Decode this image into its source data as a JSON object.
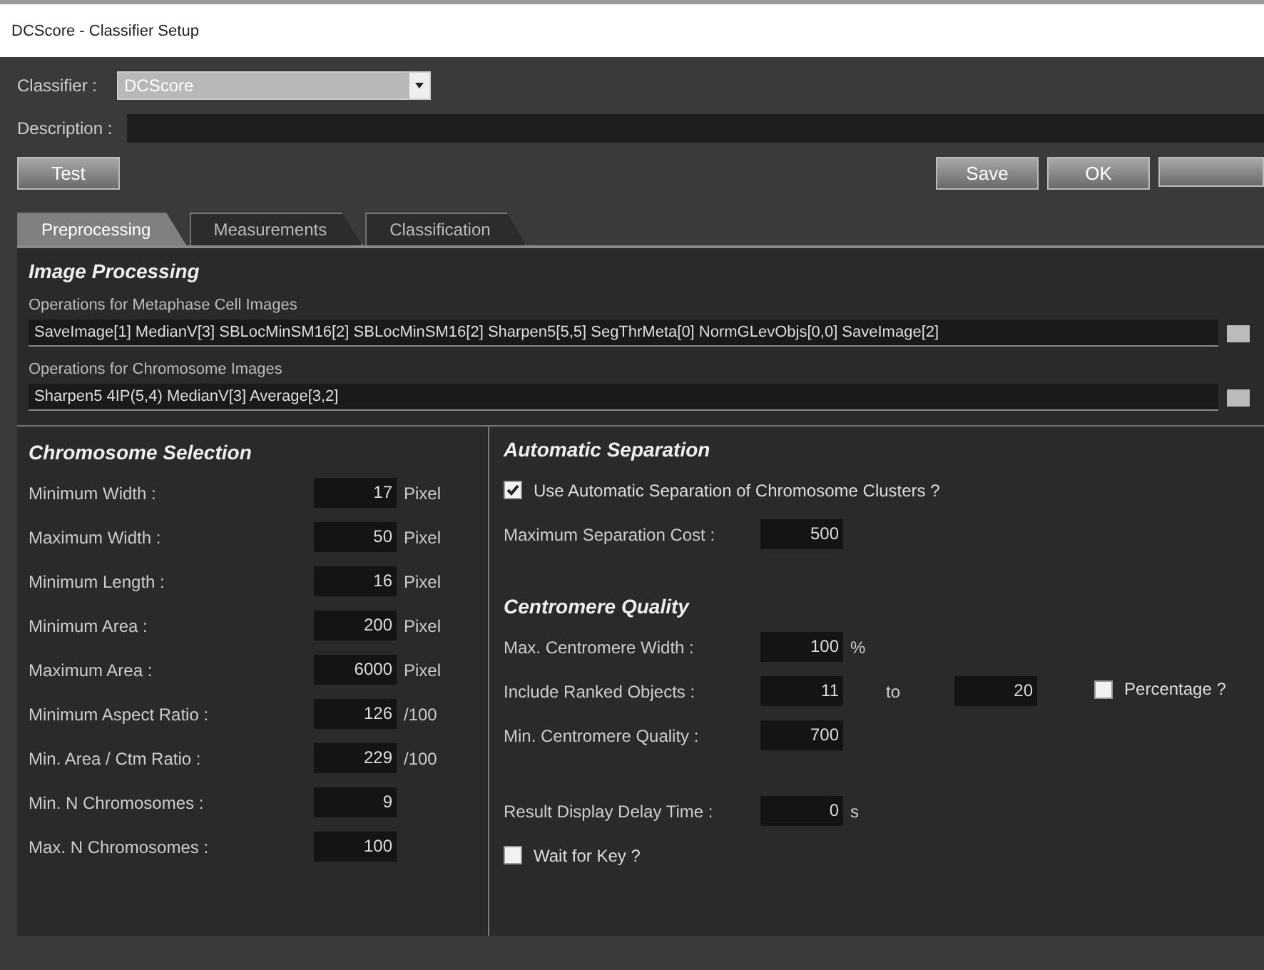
{
  "window": {
    "title": "DCScore - Classifier Setup"
  },
  "classifier": {
    "label": "Classifier :",
    "value": "DCScore"
  },
  "description": {
    "label": "Description :"
  },
  "test_button": "Test",
  "actions": [
    "Save",
    "OK"
  ],
  "tabs": [
    {
      "label": "Preprocessing",
      "selected": true
    },
    {
      "label": "Measurements",
      "selected": false
    },
    {
      "label": "Classification",
      "selected": false
    }
  ],
  "image_processing": {
    "title": "Image Processing",
    "operations": [
      {
        "label": "Operations for Metaphase Cell Images",
        "value": "SaveImage[1] MedianV[3] SBLocMinSM16[2] SBLocMinSM16[2] Sharpen5[5,5] SegThrMeta[0] NormGLevObjs[0,0] SaveImage[2]"
      },
      {
        "label": "Operations for Chromosome Images",
        "value": "Sharpen5 4IP(5,4) MedianV[3] Average[3,2]"
      }
    ]
  },
  "chromosome_selection": {
    "title": "Chromosome Selection",
    "fields": [
      {
        "label": "Minimum Width :",
        "value": "17",
        "unit": "Pixel"
      },
      {
        "label": "Maximum Width :",
        "value": "50",
        "unit": "Pixel"
      },
      {
        "label": "Minimum Length :",
        "value": "16",
        "unit": "Pixel"
      },
      {
        "label": "Minimum Area :",
        "value": "200",
        "unit": "Pixel"
      },
      {
        "label": "Maximum Area :",
        "value": "6000",
        "unit": "Pixel"
      },
      {
        "label": "Minimum Aspect Ratio :",
        "value": "126",
        "unit": "/100"
      },
      {
        "label": "Min. Area / Ctm Ratio :",
        "value": "229",
        "unit": "/100"
      },
      {
        "label": "Min. N Chromosomes :",
        "value": "9"
      },
      {
        "label": "Max. N Chromosomes :",
        "value": "100"
      }
    ]
  },
  "automatic_separation": {
    "title": "Automatic Separation",
    "use": {
      "label": "Use Automatic Separation of Chromosome Clusters ?",
      "checked": true
    },
    "cost": {
      "label": "Maximum Separation Cost :",
      "value": "500"
    }
  },
  "centromere_quality": {
    "title": "Centromere Quality",
    "max_width": {
      "label": "Max. Centromere Width :",
      "value": "100",
      "unit": "%"
    },
    "ranked": {
      "label": "Include Ranked Objects :",
      "from": "11",
      "to_label": "to",
      "to": "20",
      "percentage": {
        "label": "Percentage ?",
        "checked": false
      }
    },
    "min_quality": {
      "label": "Min. Centromere Quality :",
      "value": "700"
    }
  },
  "delay": {
    "label": "Result Display Delay Time :",
    "value": "0",
    "unit": "s"
  },
  "wait_for_key": {
    "label": "Wait for Key ?",
    "checked": false
  }
}
